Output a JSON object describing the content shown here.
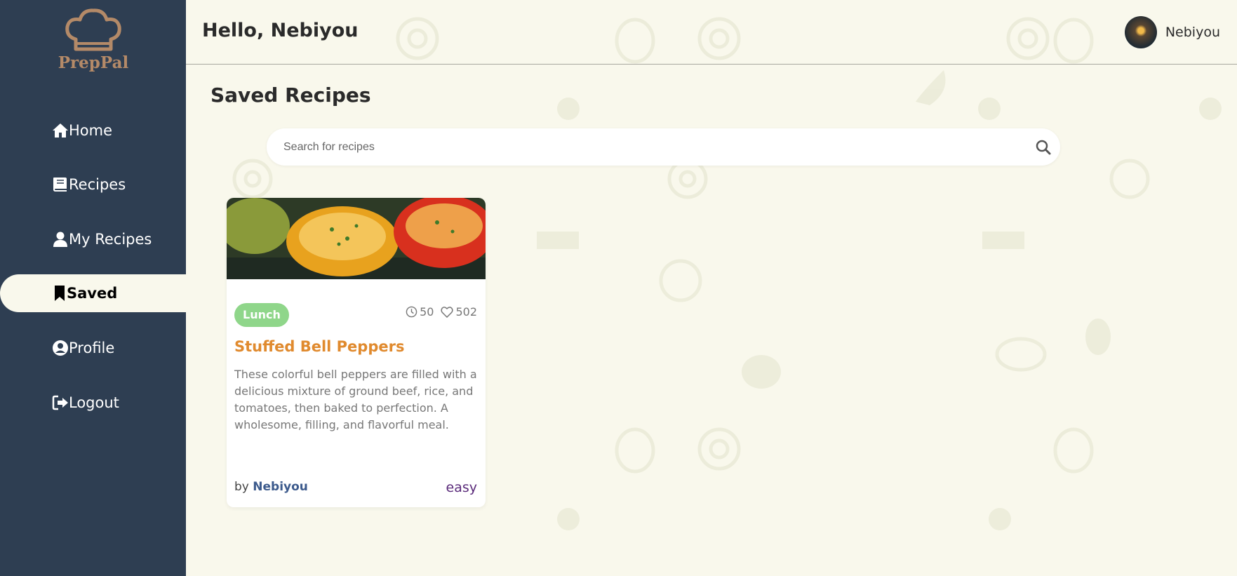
{
  "app": {
    "logo_text": "PrepPal"
  },
  "header": {
    "greeting": "Hello, Nebiyou",
    "user_name": "Nebiyou"
  },
  "sidebar": {
    "items": [
      {
        "label": "Home",
        "icon": "home-icon",
        "active": false
      },
      {
        "label": "Recipes",
        "icon": "book-icon",
        "active": false
      },
      {
        "label": "My Recipes",
        "icon": "user-icon",
        "active": false
      },
      {
        "label": "Saved",
        "icon": "bookmark-icon",
        "active": true
      },
      {
        "label": "Profile",
        "icon": "user-circle-icon",
        "active": false
      },
      {
        "label": "Logout",
        "icon": "logout-icon",
        "active": false
      }
    ]
  },
  "main": {
    "title": "Saved Recipes",
    "search": {
      "placeholder": "Search for recipes",
      "value": ""
    },
    "recipes": [
      {
        "category": "Lunch",
        "time": "50",
        "likes": "502",
        "title": "Stuffed Bell Peppers",
        "description": "These colorful bell peppers are filled with a delicious mixture of ground beef, rice, and tomatoes, then baked to perfection. A wholesome, filling, and flavorful meal.",
        "by_prefix": "by",
        "author": "Nebiyou",
        "difficulty": "easy"
      }
    ]
  },
  "colors": {
    "sidebar_bg": "#2e3e52",
    "page_bg": "#f9f8ec",
    "accent_orange": "#e08a2e",
    "tag_green": "#8fd68a",
    "author_blue": "#3c5a8c",
    "difficulty_purple": "#5a2a7a"
  }
}
